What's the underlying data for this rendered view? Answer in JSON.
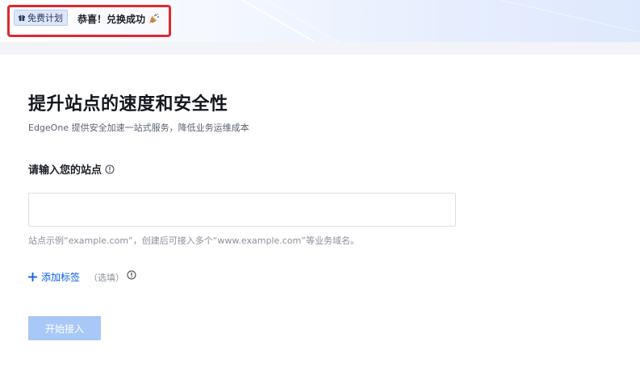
{
  "banner": {
    "plan_badge": "免费计划",
    "congrats": "恭喜！兑换成功"
  },
  "main": {
    "title": "提升站点的速度和安全性",
    "subtitle": "EdgeOne 提供安全加速一站式服务，降低业务运维成本",
    "site_label": "请输入您的站点",
    "site_input_value": "",
    "site_input_placeholder": "",
    "hint": "站点示例“example.com”，创建后可接入多个“www.example.com”等业务域名。",
    "add_tag_label": "添加标签",
    "optional_label": "（选填）",
    "start_button_label": "开始接入"
  },
  "colors": {
    "accent": "#0a5ee8",
    "button_disabled": "#a9c8f8",
    "highlight": "#e0282e"
  },
  "icons": {
    "plan": "gift-icon",
    "congrats": "party-popper-icon",
    "label_info": "info-icon",
    "add": "plus-icon",
    "tag_info": "info-icon"
  }
}
